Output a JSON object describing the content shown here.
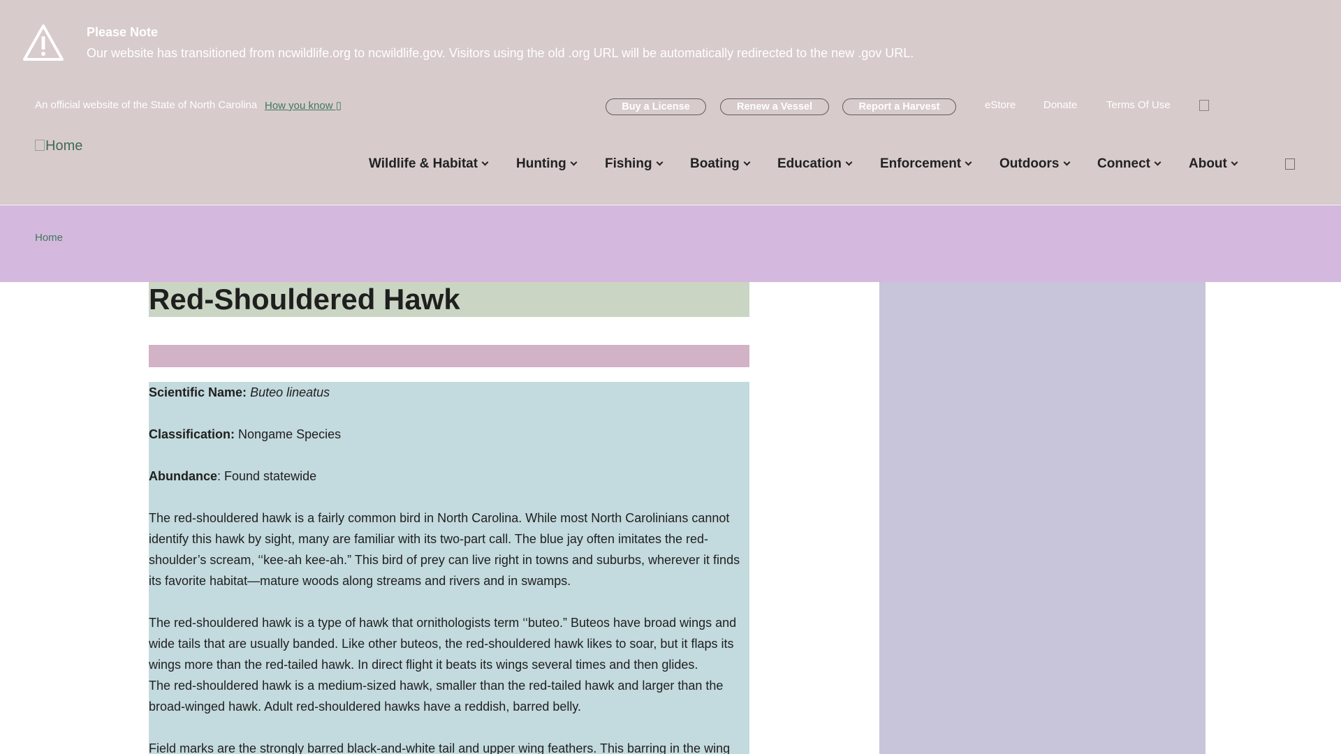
{
  "notice": {
    "title": "Please Note",
    "text": "Our website has transitioned from ncwildlife.org to ncwildlife.gov. Visitors using the old .org URL will be automatically redirected to the new .gov URL.",
    "icon": "warning-triangle-icon"
  },
  "header": {
    "official_text": "An official website of the State of North Carolina",
    "how_you_know": "How you know ▯",
    "buttons": {
      "buy_license": "Buy a License",
      "renew_vessel": "Renew a Vessel",
      "report_harvest": "Report a Harvest"
    },
    "links": {
      "estore": "eStore",
      "donate": "Donate",
      "terms": "Terms Of Use"
    },
    "logo_alt": "Home"
  },
  "nav": {
    "items": [
      {
        "label": "Wildlife & Habitat"
      },
      {
        "label": "Hunting"
      },
      {
        "label": "Fishing"
      },
      {
        "label": "Boating"
      },
      {
        "label": "Education"
      },
      {
        "label": "Enforcement"
      },
      {
        "label": "Outdoors"
      },
      {
        "label": "Connect"
      },
      {
        "label": "About"
      }
    ]
  },
  "breadcrumb": {
    "home": "Home"
  },
  "main": {
    "title": "Red-Shouldered Hawk",
    "scientific_label": "Scientific Name:",
    "scientific_value": "Buteo lineatus",
    "classification_label": "Classification:",
    "classification_value": "Nongame Species",
    "abundance_label": "Abundance",
    "abundance_value": ": Found statewide",
    "para1": "The red-shouldered hawk is a fairly common bird in North Carolina. While most North Carolinians cannot identify this hawk by sight, many are familiar with its two-part call. The blue jay often imitates the red-shoulder’s scream, ‘‘kee-ah kee-ah.” This bird of prey can live right in towns and suburbs, wherever it finds its favorite habitat—mature woods along streams and rivers and in swamps.",
    "para2": "The red-shouldered hawk is a type of hawk that ornithologists term ‘‘buteo.” Buteos have broad wings and wide tails that are usually banded. Like other buteos, the red-shouldered hawk likes to soar, but it flaps its wings more than the red-tailed hawk. In direct flight it beats its wings several times and then glides.",
    "para3": "The red-shouldered hawk is a medium-sized hawk, smaller than the red-tailed hawk and larger than the broad-winged hawk. Adult red-shouldered hawks have a reddish, barred belly.",
    "para4": "Field marks are the strongly barred black-and-white tail and upper wing feathers. This barring in the wing"
  },
  "colors": {
    "notice_bg": "#d8cbcb",
    "breadcrumb_bg": "#d5b8de",
    "link_green": "#3d7a5d"
  }
}
